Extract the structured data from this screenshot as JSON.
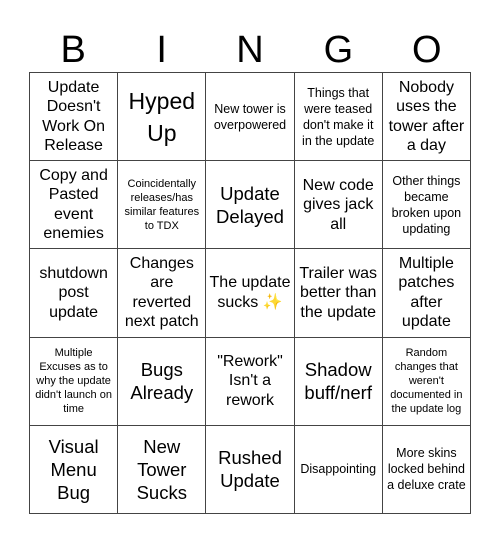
{
  "header": {
    "letters": [
      "B",
      "I",
      "N",
      "G",
      "O"
    ]
  },
  "cells": [
    {
      "text": "Update Doesn't Work On Release",
      "size": "m"
    },
    {
      "text": "Hyped Up",
      "size": "xl"
    },
    {
      "text": "New tower is overpowered",
      "size": "s"
    },
    {
      "text": "Things that were teased don't make it in the update",
      "size": "s"
    },
    {
      "text": "Nobody uses the tower after a day",
      "size": "m"
    },
    {
      "text": "Copy and Pasted event enemies",
      "size": "m"
    },
    {
      "text": "Coincidentally releases/has similar features to TDX",
      "size": "xs"
    },
    {
      "text": "Update Delayed",
      "size": "l"
    },
    {
      "text": "New code gives jack all",
      "size": "m"
    },
    {
      "text": "Other things became broken upon updating",
      "size": "s"
    },
    {
      "text": "shutdown post update",
      "size": "m"
    },
    {
      "text": "Changes are reverted next patch",
      "size": "m"
    },
    {
      "text": "The update sucks ✨",
      "size": "m"
    },
    {
      "text": "Trailer was better than the update",
      "size": "m"
    },
    {
      "text": "Multiple patches after update",
      "size": "m"
    },
    {
      "text": "Multiple Excuses as to why the update didn't launch on time",
      "size": "xs"
    },
    {
      "text": "Bugs Already",
      "size": "l"
    },
    {
      "text": "\"Rework\" Isn't a rework",
      "size": "m"
    },
    {
      "text": "Shadow buff/nerf",
      "size": "l"
    },
    {
      "text": "Random changes that weren't documented in the update log",
      "size": "xs"
    },
    {
      "text": "Visual Menu Bug",
      "size": "l"
    },
    {
      "text": "New Tower Sucks",
      "size": "l"
    },
    {
      "text": "Rushed Update",
      "size": "l"
    },
    {
      "text": "Disappointing",
      "size": "s"
    },
    {
      "text": "More skins locked behind a deluxe crate",
      "size": "s"
    }
  ]
}
